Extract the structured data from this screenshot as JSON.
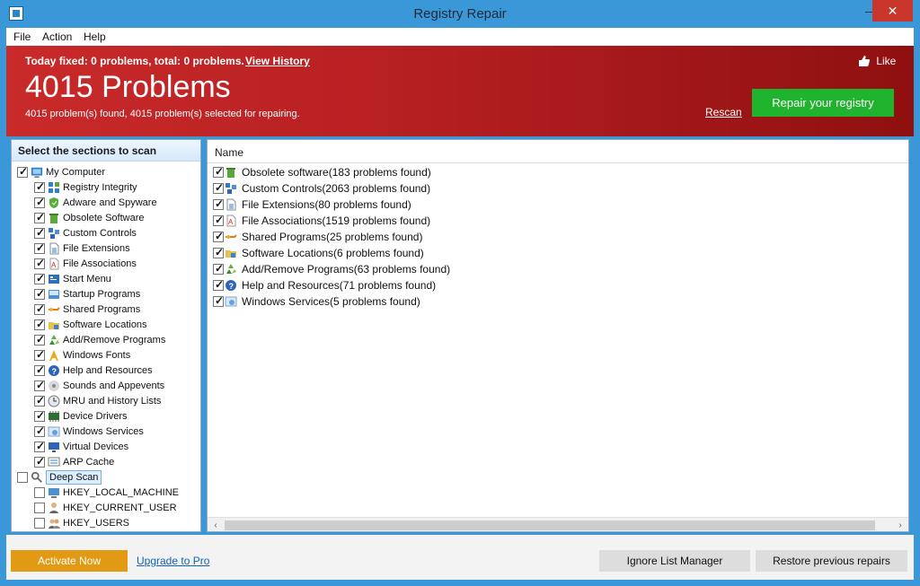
{
  "window": {
    "title": "Registry Repair",
    "minimize": "—",
    "maximize": "□",
    "close": "✕"
  },
  "menu": {
    "items": [
      "File",
      "Action",
      "Help"
    ]
  },
  "banner": {
    "today_fixed": "Today fixed: 0 problems, total: 0 problems.",
    "view_history": "View History",
    "like": "Like",
    "problems_count": "4015 Problems",
    "summary": "4015 problem(s) found, 4015 problem(s) selected for repairing.",
    "rescan": "Rescan",
    "repair_button": "Repair your registry"
  },
  "left_panel": {
    "header": "Select the sections to scan",
    "my_computer": "My Computer",
    "sections": [
      {
        "label": "Registry Integrity",
        "checked": true,
        "icon": "blocks-icon"
      },
      {
        "label": "Adware and Spyware",
        "checked": true,
        "icon": "shield-icon"
      },
      {
        "label": "Obsolete Software",
        "checked": true,
        "icon": "recycle-bin-icon"
      },
      {
        "label": "Custom Controls",
        "checked": true,
        "icon": "controls-icon"
      },
      {
        "label": "File Extensions",
        "checked": true,
        "icon": "document-icon"
      },
      {
        "label": "File Associations",
        "checked": true,
        "icon": "file-association-icon"
      },
      {
        "label": "Start Menu",
        "checked": true,
        "icon": "start-menu-icon"
      },
      {
        "label": "Startup Programs",
        "checked": true,
        "icon": "startup-icon"
      },
      {
        "label": "Shared Programs",
        "checked": true,
        "icon": "shared-programs-icon"
      },
      {
        "label": "Software Locations",
        "checked": true,
        "icon": "folder-icon"
      },
      {
        "label": "Add/Remove Programs",
        "checked": true,
        "icon": "add-remove-icon"
      },
      {
        "label": "Windows Fonts",
        "checked": true,
        "icon": "font-icon"
      },
      {
        "label": "Help and Resources",
        "checked": true,
        "icon": "help-icon"
      },
      {
        "label": "Sounds and Appevents",
        "checked": true,
        "icon": "sound-icon"
      },
      {
        "label": "MRU and History Lists",
        "checked": true,
        "icon": "history-icon"
      },
      {
        "label": "Device Drivers",
        "checked": true,
        "icon": "driver-icon"
      },
      {
        "label": "Windows Services",
        "checked": true,
        "icon": "services-icon"
      },
      {
        "label": "Virtual Devices",
        "checked": true,
        "icon": "virtual-device-icon"
      },
      {
        "label": "ARP Cache",
        "checked": true,
        "icon": "network-icon"
      }
    ],
    "deep_scan": "Deep Scan",
    "deep_scan_keys": [
      {
        "label": "HKEY_LOCAL_MACHINE",
        "checked": false,
        "icon": "computer-key-icon"
      },
      {
        "label": "HKEY_CURRENT_USER",
        "checked": false,
        "icon": "user-key-icon"
      },
      {
        "label": "HKEY_USERS",
        "checked": false,
        "icon": "users-key-icon"
      }
    ]
  },
  "results": {
    "name_header": "Name",
    "items": [
      {
        "label": "Obsolete software(183 problems found)",
        "checked": true,
        "icon": "recycle-bin-icon"
      },
      {
        "label": "Custom Controls(2063 problems found)",
        "checked": true,
        "icon": "controls-icon"
      },
      {
        "label": "File Extensions(80 problems found)",
        "checked": true,
        "icon": "document-icon"
      },
      {
        "label": "File Associations(1519 problems found)",
        "checked": true,
        "icon": "file-association-icon"
      },
      {
        "label": "Shared Programs(25 problems found)",
        "checked": true,
        "icon": "shared-programs-icon"
      },
      {
        "label": "Software Locations(6 problems found)",
        "checked": true,
        "icon": "folder-icon"
      },
      {
        "label": "Add/Remove Programs(63 problems found)",
        "checked": true,
        "icon": "add-remove-icon"
      },
      {
        "label": "Help and Resources(71 problems found)",
        "checked": true,
        "icon": "help-icon"
      },
      {
        "label": "Windows Services(5 problems found)",
        "checked": true,
        "icon": "services-icon"
      }
    ],
    "scroll_left": "‹",
    "scroll_right": "›"
  },
  "footer": {
    "activate_now": "Activate Now",
    "upgrade_to_pro": "Upgrade to Pro",
    "ignore_list_manager": "Ignore List Manager",
    "restore_previous_repairs": "Restore previous repairs"
  },
  "colors": {
    "window_frame": "#3b98d8",
    "banner_red": "#c92a2a",
    "repair_green": "#20b32e",
    "activate_orange": "#e29a14",
    "link_blue": "#0f61b8"
  }
}
